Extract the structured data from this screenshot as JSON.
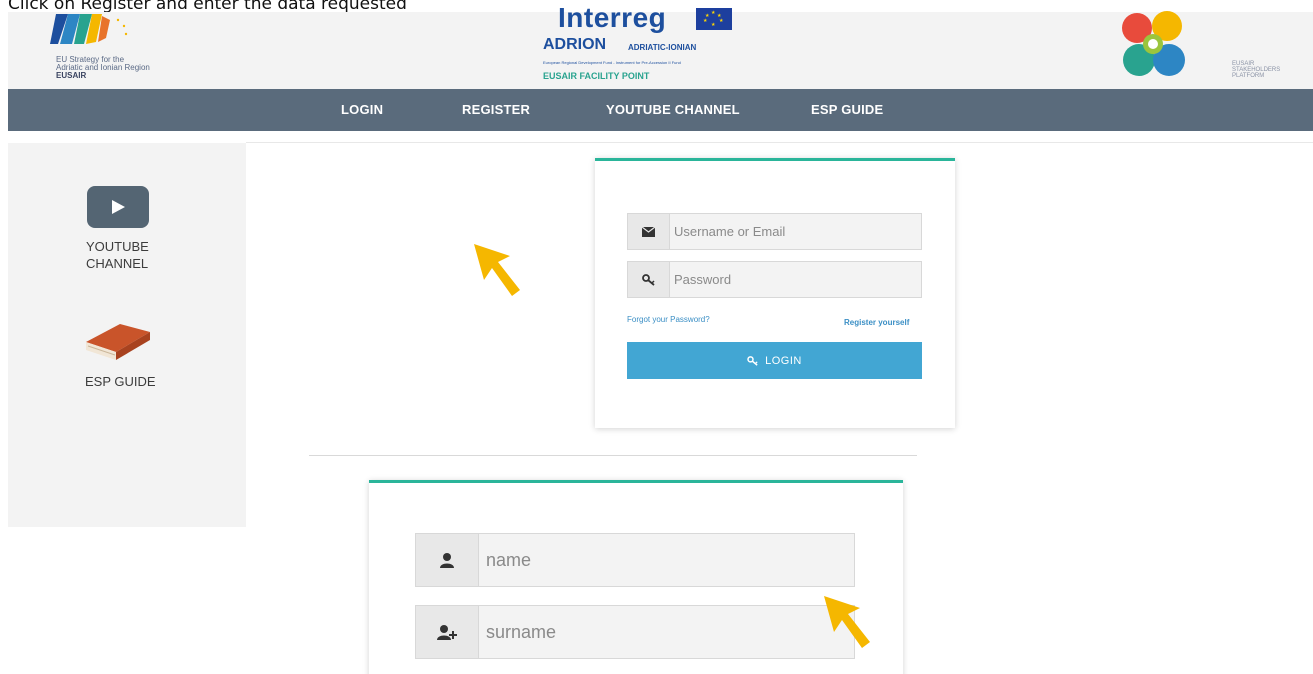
{
  "caption": "Click on Register and enter the data requested",
  "header": {
    "eusair": {
      "line1": "EU Strategy for the",
      "line2": "Adriatic and Ionian Region",
      "line3": "EUSAIR"
    },
    "interreg": {
      "word": "Interreg",
      "adrion": "ADRION",
      "adriatic": "ADRIATIC-IONIAN",
      "fund": "European Regional Development Fund - Instrument for Pre-Accession II Fund",
      "facility": "EUSAIR FACILITY POINT"
    },
    "esp": {
      "line1": "EUSAIR",
      "line2": "STAKEHOLDERS",
      "line3": "PLATFORM"
    }
  },
  "nav": {
    "items": [
      {
        "label": "LOGIN"
      },
      {
        "label": "REGISTER"
      },
      {
        "label": "YOUTUBE CHANNEL"
      },
      {
        "label": "ESP GUIDE"
      }
    ]
  },
  "sidebar": {
    "youtube_line1": "YOUTUBE",
    "youtube_line2": "CHANNEL",
    "guide_label": "ESP GUIDE"
  },
  "login_form": {
    "username_placeholder": "Username or Email",
    "password_placeholder": "Password",
    "forgot_label": "Forgot your Password?",
    "register_label": "Register yourself",
    "login_button": "LOGIN"
  },
  "register_form": {
    "name_placeholder": "name",
    "surname_placeholder": "surname"
  },
  "colors": {
    "nav_bg": "#5a6b7c",
    "accent_teal": "#2ab59a",
    "login_button": "#42a6d3",
    "cursor_yellow": "#f5b700"
  },
  "icons": [
    "youtube-play-icon",
    "book-icon",
    "envelope-icon",
    "key-icon",
    "user-icon",
    "user-plus-icon",
    "cursor-arrow-icon"
  ]
}
